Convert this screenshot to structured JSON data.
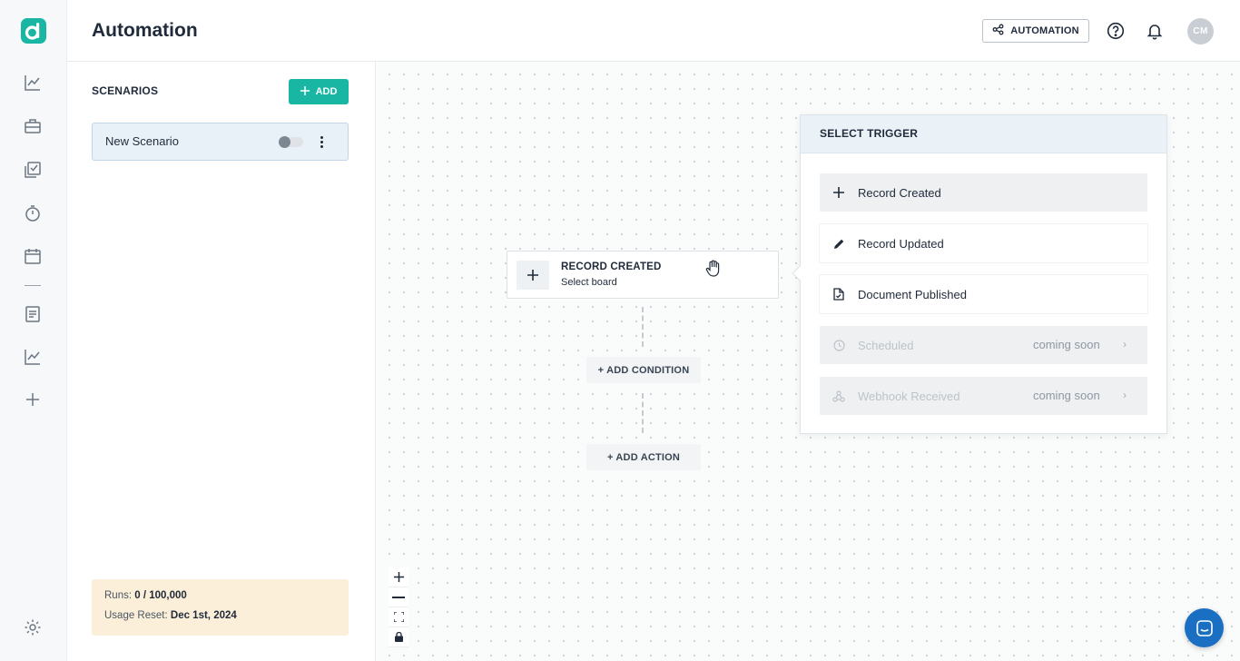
{
  "header": {
    "title": "Automation",
    "automation_button": "AUTOMATION",
    "avatar_initials": "CM"
  },
  "rail": {
    "icons": [
      "app-logo",
      "chart-icon",
      "briefcase-icon",
      "tasks-icon",
      "timer-icon",
      "calendar-icon",
      "document-icon",
      "chart-icon",
      "plus-icon",
      "settings-icon"
    ]
  },
  "scenarios": {
    "title": "SCENARIOS",
    "add_label": "ADD",
    "items": [
      {
        "name": "New Scenario",
        "enabled": false
      }
    ],
    "runs_label": "Runs:",
    "runs_value": "0 / 100,000",
    "reset_label": "Usage Reset:",
    "reset_value": "Dec 1st, 2024"
  },
  "canvas": {
    "trigger_node": {
      "title": "RECORD CREATED",
      "subtitle": "Select board"
    },
    "add_condition": "+ ADD CONDITION",
    "add_action": "+ ADD ACTION"
  },
  "trigger_panel": {
    "title": "SELECT TRIGGER",
    "options": [
      {
        "label": "Record Created",
        "icon": "plus-icon",
        "state": "highlighted"
      },
      {
        "label": "Record Updated",
        "icon": "pencil-icon",
        "state": "normal"
      },
      {
        "label": "Document Published",
        "icon": "document-icon",
        "state": "normal"
      },
      {
        "label": "Scheduled",
        "icon": "clock-icon",
        "state": "disabled",
        "badge": "coming soon"
      },
      {
        "label": "Webhook Received",
        "icon": "webhook-icon",
        "state": "disabled",
        "badge": "coming soon"
      }
    ]
  },
  "colors": {
    "accent": "#19b6a4",
    "usage_bg": "#fcefd9",
    "selected_bg": "#e9f1f8",
    "chat": "#1b6fc2"
  }
}
